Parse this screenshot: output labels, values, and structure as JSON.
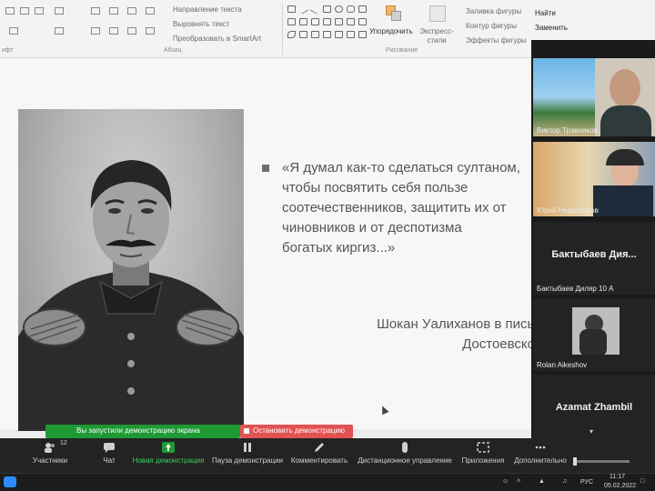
{
  "ribbon": {
    "text_direction": "Направление текста",
    "align_text": "Выровнять текст",
    "convert_smartart": "Преобразовать в SmartArt",
    "paragraph_group": "Абзац",
    "font_group": "ифт",
    "arrange": "Упорядочить",
    "quick_styles": "Экспресс-стили",
    "shape_fill": "Заливка фигуры",
    "shape_outline": "Контур фигуры",
    "shape_effects": "Эффекты фигуры",
    "drawing_group": "Рисование",
    "find": "Найти",
    "replace": "Заменить"
  },
  "slide": {
    "quote": "«Я думал как-то сделаться султаном,\nчтобы посвятить себя пользе\nсоотечественников, защитить их от\nчиновников и от деспотизма\nбогатых киргиз...»",
    "attribution": "Шокан Уалиханов в письме\nДостоевскому"
  },
  "participants": [
    {
      "name": "Виктор Травников"
    },
    {
      "name": "Юрий Недобитков"
    },
    {
      "display_name": "Бактыбаев  Дия...",
      "name": "Бактыбаев Диляр 10 А"
    },
    {
      "name": "Rolan Aikeshov"
    },
    {
      "display_name": "Azamat Zhambil"
    }
  ],
  "share_banner": {
    "status": "Вы запустили демонстрацию экрана",
    "stop": "Остановить демонстрацию"
  },
  "toolbar": {
    "participants_count": "12",
    "participants": "Участники",
    "chat": "Чат",
    "new_share": "Новая демонстрация",
    "pause_share": "Пауза демонстрации",
    "annotate": "Комментировать",
    "remote_control": "Дистанционное управление",
    "apps": "Приложения",
    "more": "Дополнительно"
  },
  "taskbar": {
    "language": "РУС",
    "time": "11:17",
    "date": "05.02.2022"
  },
  "colors": {
    "share_green": "#1e9a34",
    "stop_red": "#e25253",
    "zoom_dark": "#232323"
  }
}
